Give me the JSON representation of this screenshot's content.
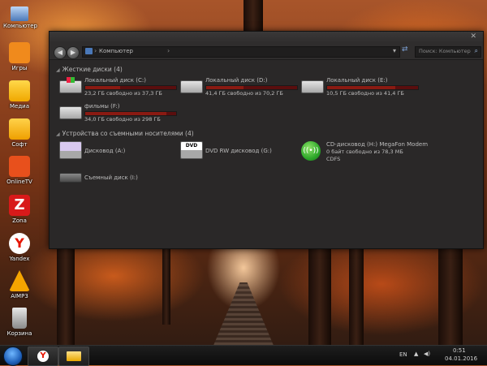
{
  "desktop": {
    "icons": [
      {
        "label": "Компьютер",
        "icon": "computer-icon",
        "color": "#5a8fd8"
      },
      {
        "label": "Игры",
        "icon": "gamepad-icon",
        "color": "#f08a1c"
      },
      {
        "label": "Медиа",
        "icon": "folder-icon",
        "color": "#f0b400"
      },
      {
        "label": "Софт",
        "icon": "folder-icon",
        "color": "#f0a800"
      },
      {
        "label": "OnlineTV",
        "icon": "tv-icon",
        "color": "#e8501c"
      },
      {
        "label": "Zona",
        "icon": "zona-icon",
        "color": "#d81a1a"
      },
      {
        "label": "Yandex",
        "icon": "yandex-icon",
        "color": "#ffffff"
      },
      {
        "label": "AIMP3",
        "icon": "aimp-icon",
        "color": "#f5a400"
      },
      {
        "label": "Корзина",
        "icon": "recycle-bin-icon",
        "color": "#bbbbbb"
      }
    ]
  },
  "window": {
    "address": {
      "path": "Компьютер"
    },
    "search_placeholder": "Поиск: Компьютер",
    "hard_drives_header": "Жесткие диски (4)",
    "removable_header": "Устройства со съемными носителями (4)",
    "hard_drives": [
      {
        "name": "Локальный диск (C:)",
        "free": "23,2 ГБ свободно из 37,3 ГБ",
        "used_fraction": 0.38,
        "system": true
      },
      {
        "name": "Локальный диск (D:)",
        "free": "41,4 ГБ свободно из 70,2 ГБ",
        "used_fraction": 0.41,
        "system": false
      },
      {
        "name": "Локальный диск (E:)",
        "free": "10,5 ГБ свободно из 41,4 ГБ",
        "used_fraction": 0.75,
        "system": false
      },
      {
        "name": "фильмы (F:)",
        "free": "34,0 ГБ свободно из 298 ГБ",
        "used_fraction": 0.89,
        "system": false
      }
    ],
    "removable": [
      {
        "name": "Дисковод (A:)",
        "icon": "floppy-drive-icon"
      },
      {
        "name": "DVD RW дисковод (G:)",
        "icon": "dvd-drive-icon"
      },
      {
        "name": "CD-дисковод (H:) MegaFon Modem",
        "line2": "0 байт свободно из 78,3 МБ",
        "line3": "CDFS",
        "icon": "modem-icon"
      },
      {
        "name": "Съемный диск (I:)",
        "icon": "removable-disk-icon"
      }
    ]
  },
  "taskbar": {
    "language": "EN",
    "time": "0:51",
    "date": "04.01.2016"
  }
}
